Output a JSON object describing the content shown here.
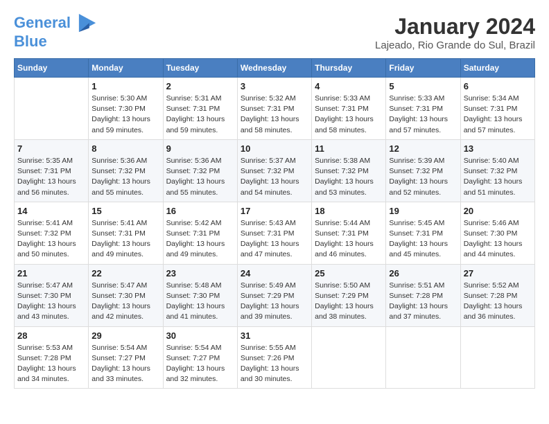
{
  "header": {
    "logo_line1": "General",
    "logo_line2": "Blue",
    "month": "January 2024",
    "location": "Lajeado, Rio Grande do Sul, Brazil"
  },
  "weekdays": [
    "Sunday",
    "Monday",
    "Tuesday",
    "Wednesday",
    "Thursday",
    "Friday",
    "Saturday"
  ],
  "weeks": [
    [
      {
        "day": "",
        "sunrise": "",
        "sunset": "",
        "daylight": ""
      },
      {
        "day": "1",
        "sunrise": "Sunrise: 5:30 AM",
        "sunset": "Sunset: 7:30 PM",
        "daylight": "Daylight: 13 hours and 59 minutes."
      },
      {
        "day": "2",
        "sunrise": "Sunrise: 5:31 AM",
        "sunset": "Sunset: 7:31 PM",
        "daylight": "Daylight: 13 hours and 59 minutes."
      },
      {
        "day": "3",
        "sunrise": "Sunrise: 5:32 AM",
        "sunset": "Sunset: 7:31 PM",
        "daylight": "Daylight: 13 hours and 58 minutes."
      },
      {
        "day": "4",
        "sunrise": "Sunrise: 5:33 AM",
        "sunset": "Sunset: 7:31 PM",
        "daylight": "Daylight: 13 hours and 58 minutes."
      },
      {
        "day": "5",
        "sunrise": "Sunrise: 5:33 AM",
        "sunset": "Sunset: 7:31 PM",
        "daylight": "Daylight: 13 hours and 57 minutes."
      },
      {
        "day": "6",
        "sunrise": "Sunrise: 5:34 AM",
        "sunset": "Sunset: 7:31 PM",
        "daylight": "Daylight: 13 hours and 57 minutes."
      }
    ],
    [
      {
        "day": "7",
        "sunrise": "Sunrise: 5:35 AM",
        "sunset": "Sunset: 7:31 PM",
        "daylight": "Daylight: 13 hours and 56 minutes."
      },
      {
        "day": "8",
        "sunrise": "Sunrise: 5:36 AM",
        "sunset": "Sunset: 7:32 PM",
        "daylight": "Daylight: 13 hours and 55 minutes."
      },
      {
        "day": "9",
        "sunrise": "Sunrise: 5:36 AM",
        "sunset": "Sunset: 7:32 PM",
        "daylight": "Daylight: 13 hours and 55 minutes."
      },
      {
        "day": "10",
        "sunrise": "Sunrise: 5:37 AM",
        "sunset": "Sunset: 7:32 PM",
        "daylight": "Daylight: 13 hours and 54 minutes."
      },
      {
        "day": "11",
        "sunrise": "Sunrise: 5:38 AM",
        "sunset": "Sunset: 7:32 PM",
        "daylight": "Daylight: 13 hours and 53 minutes."
      },
      {
        "day": "12",
        "sunrise": "Sunrise: 5:39 AM",
        "sunset": "Sunset: 7:32 PM",
        "daylight": "Daylight: 13 hours and 52 minutes."
      },
      {
        "day": "13",
        "sunrise": "Sunrise: 5:40 AM",
        "sunset": "Sunset: 7:32 PM",
        "daylight": "Daylight: 13 hours and 51 minutes."
      }
    ],
    [
      {
        "day": "14",
        "sunrise": "Sunrise: 5:41 AM",
        "sunset": "Sunset: 7:32 PM",
        "daylight": "Daylight: 13 hours and 50 minutes."
      },
      {
        "day": "15",
        "sunrise": "Sunrise: 5:41 AM",
        "sunset": "Sunset: 7:31 PM",
        "daylight": "Daylight: 13 hours and 49 minutes."
      },
      {
        "day": "16",
        "sunrise": "Sunrise: 5:42 AM",
        "sunset": "Sunset: 7:31 PM",
        "daylight": "Daylight: 13 hours and 49 minutes."
      },
      {
        "day": "17",
        "sunrise": "Sunrise: 5:43 AM",
        "sunset": "Sunset: 7:31 PM",
        "daylight": "Daylight: 13 hours and 47 minutes."
      },
      {
        "day": "18",
        "sunrise": "Sunrise: 5:44 AM",
        "sunset": "Sunset: 7:31 PM",
        "daylight": "Daylight: 13 hours and 46 minutes."
      },
      {
        "day": "19",
        "sunrise": "Sunrise: 5:45 AM",
        "sunset": "Sunset: 7:31 PM",
        "daylight": "Daylight: 13 hours and 45 minutes."
      },
      {
        "day": "20",
        "sunrise": "Sunrise: 5:46 AM",
        "sunset": "Sunset: 7:30 PM",
        "daylight": "Daylight: 13 hours and 44 minutes."
      }
    ],
    [
      {
        "day": "21",
        "sunrise": "Sunrise: 5:47 AM",
        "sunset": "Sunset: 7:30 PM",
        "daylight": "Daylight: 13 hours and 43 minutes."
      },
      {
        "day": "22",
        "sunrise": "Sunrise: 5:47 AM",
        "sunset": "Sunset: 7:30 PM",
        "daylight": "Daylight: 13 hours and 42 minutes."
      },
      {
        "day": "23",
        "sunrise": "Sunrise: 5:48 AM",
        "sunset": "Sunset: 7:30 PM",
        "daylight": "Daylight: 13 hours and 41 minutes."
      },
      {
        "day": "24",
        "sunrise": "Sunrise: 5:49 AM",
        "sunset": "Sunset: 7:29 PM",
        "daylight": "Daylight: 13 hours and 39 minutes."
      },
      {
        "day": "25",
        "sunrise": "Sunrise: 5:50 AM",
        "sunset": "Sunset: 7:29 PM",
        "daylight": "Daylight: 13 hours and 38 minutes."
      },
      {
        "day": "26",
        "sunrise": "Sunrise: 5:51 AM",
        "sunset": "Sunset: 7:28 PM",
        "daylight": "Daylight: 13 hours and 37 minutes."
      },
      {
        "day": "27",
        "sunrise": "Sunrise: 5:52 AM",
        "sunset": "Sunset: 7:28 PM",
        "daylight": "Daylight: 13 hours and 36 minutes."
      }
    ],
    [
      {
        "day": "28",
        "sunrise": "Sunrise: 5:53 AM",
        "sunset": "Sunset: 7:28 PM",
        "daylight": "Daylight: 13 hours and 34 minutes."
      },
      {
        "day": "29",
        "sunrise": "Sunrise: 5:54 AM",
        "sunset": "Sunset: 7:27 PM",
        "daylight": "Daylight: 13 hours and 33 minutes."
      },
      {
        "day": "30",
        "sunrise": "Sunrise: 5:54 AM",
        "sunset": "Sunset: 7:27 PM",
        "daylight": "Daylight: 13 hours and 32 minutes."
      },
      {
        "day": "31",
        "sunrise": "Sunrise: 5:55 AM",
        "sunset": "Sunset: 7:26 PM",
        "daylight": "Daylight: 13 hours and 30 minutes."
      },
      {
        "day": "",
        "sunrise": "",
        "sunset": "",
        "daylight": ""
      },
      {
        "day": "",
        "sunrise": "",
        "sunset": "",
        "daylight": ""
      },
      {
        "day": "",
        "sunrise": "",
        "sunset": "",
        "daylight": ""
      }
    ]
  ]
}
